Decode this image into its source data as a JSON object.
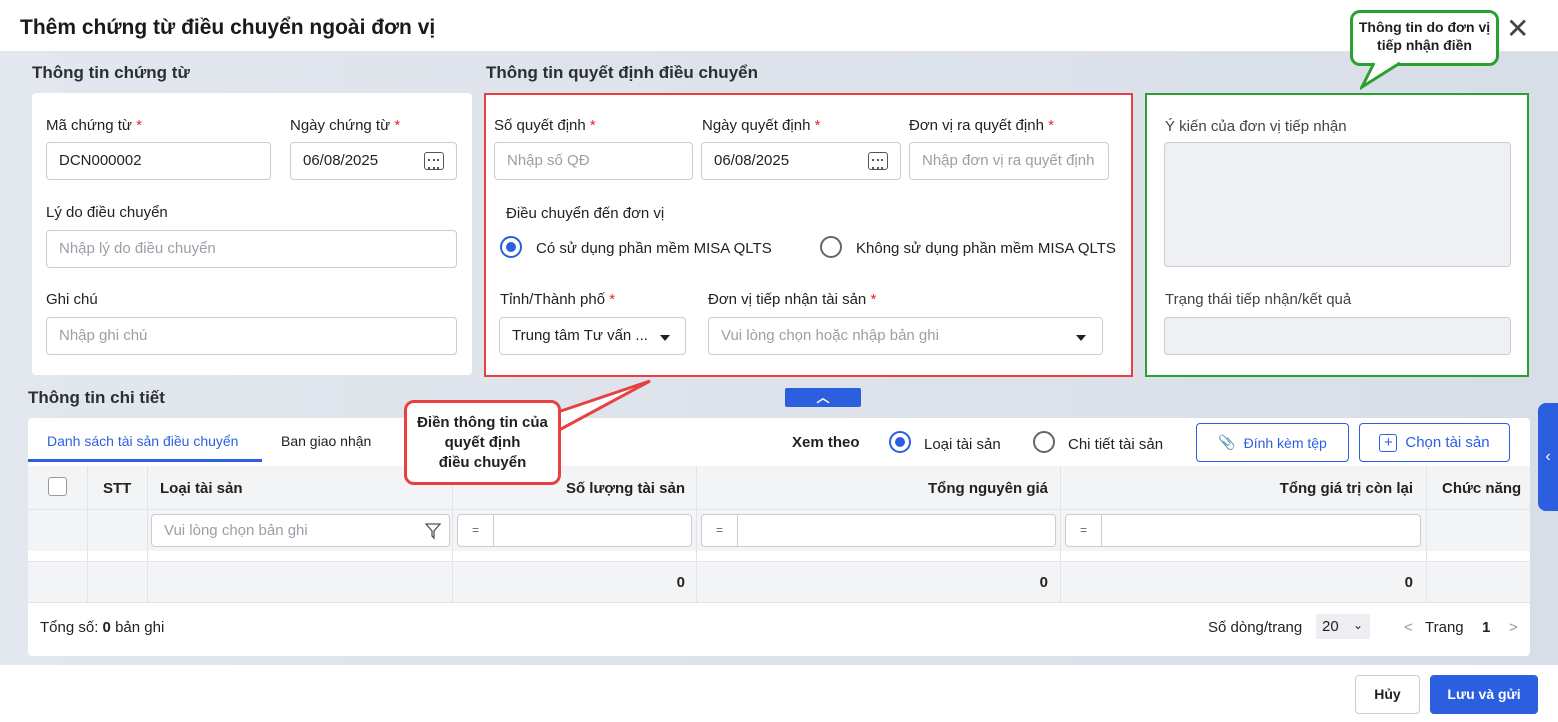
{
  "dialog": {
    "title": "Thêm chứng từ điều chuyển ngoài đơn vị"
  },
  "voucher": {
    "section": "Thông tin chứng từ",
    "code_label": "Mã chứng từ",
    "code_value": "DCN000002",
    "date_label": "Ngày chứng từ",
    "date_value": "06/08/2025",
    "reason_label": "Lý do điều chuyển",
    "reason_placeholder": "Nhập lý do điều chuyển",
    "note_label": "Ghi chú",
    "note_placeholder": "Nhập ghi chú",
    "required": "*"
  },
  "decision": {
    "section": "Thông tin quyết định điều chuyển",
    "number_label": "Số quyết định",
    "number_placeholder": "Nhập số QĐ",
    "date_label": "Ngày quyết định",
    "date_value": "06/08/2025",
    "issuer_label": "Đơn vị ra quyết định",
    "issuer_placeholder": "Nhập đơn vị ra quyết định",
    "target_label": "Điều chuyển đến đơn vị",
    "radio_yes": "Có sử dụng phần mềm MISA QLTS",
    "radio_no": "Không sử dụng phần mềm MISA QLTS",
    "province_label": "Tỉnh/Thành phố",
    "province_value": "Trung tâm Tư vấn ...",
    "receiver_label": "Đơn vị tiếp nhận tài sản",
    "receiver_placeholder": "Vui lòng chọn hoặc nhập bản ghi"
  },
  "receiver": {
    "opinion_label": "Ý kiến của đơn vị tiếp nhận",
    "status_label": "Trạng thái tiếp nhận/kết quả"
  },
  "callouts": {
    "green": "Thông tin do đơn vị tiếp nhận điền",
    "red_l1": "Điền thông tin của",
    "red_l2": "quyết định",
    "red_l3": "điều chuyển"
  },
  "detail": {
    "section": "Thông tin chi tiết",
    "tabs": [
      "Danh sách tài sản điều chuyển",
      "Ban giao nhận"
    ],
    "view_by": "Xem theo",
    "view_type": "Loại tài sản",
    "view_detail": "Chi tiết tài sản",
    "attach": "Đính kèm tệp",
    "choose": "Chọn tài sản",
    "columns": [
      "STT",
      "Loại tài sản",
      "Số lượng tài sản",
      "Tổng nguyên giá",
      "Tổng giá trị còn lại",
      "Chức năng"
    ],
    "filter_placeholder": "Vui lòng chọn bản ghi",
    "eq": "=",
    "totals": [
      "0",
      "0",
      "0"
    ],
    "total_prefix": "Tổng số:",
    "total_count": "0",
    "total_suffix": "bản ghi",
    "rows_label": "Số dòng/trang",
    "rows_value": "20",
    "page_label": "Trang",
    "page_value": "1"
  },
  "footer": {
    "cancel": "Hủy",
    "save": "Lưu và gửi"
  },
  "colors": {
    "accent": "#2b5fe0",
    "red": "#e84040",
    "green": "#2aa12e"
  }
}
